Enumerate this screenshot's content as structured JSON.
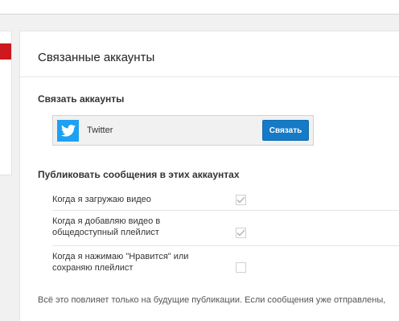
{
  "page": {
    "title": "Связанные аккаунты"
  },
  "connect_section": {
    "title": "Связать аккаунты",
    "accounts": [
      {
        "name": "Twitter",
        "icon": "twitter-bird-icon",
        "button_label": "Связать"
      }
    ]
  },
  "publish_section": {
    "title": "Публиковать сообщения в этих аккаунтах",
    "options": [
      {
        "label": "Когда я загружаю видео",
        "checked": true,
        "disabled": true
      },
      {
        "label": "Когда я добавляю видео в общедоступный плейлист",
        "checked": true,
        "disabled": true
      },
      {
        "label": "Когда я нажимаю \"Нравится\" или сохраняю плейлист",
        "checked": false,
        "disabled": true
      }
    ]
  },
  "footer_note": "Всё это повлияет только на будущие публикации. Если сообщения уже отправлены,",
  "colors": {
    "accent_red": "#cc181e",
    "button_blue": "#167ac6",
    "twitter_blue": "#1da1f2"
  }
}
